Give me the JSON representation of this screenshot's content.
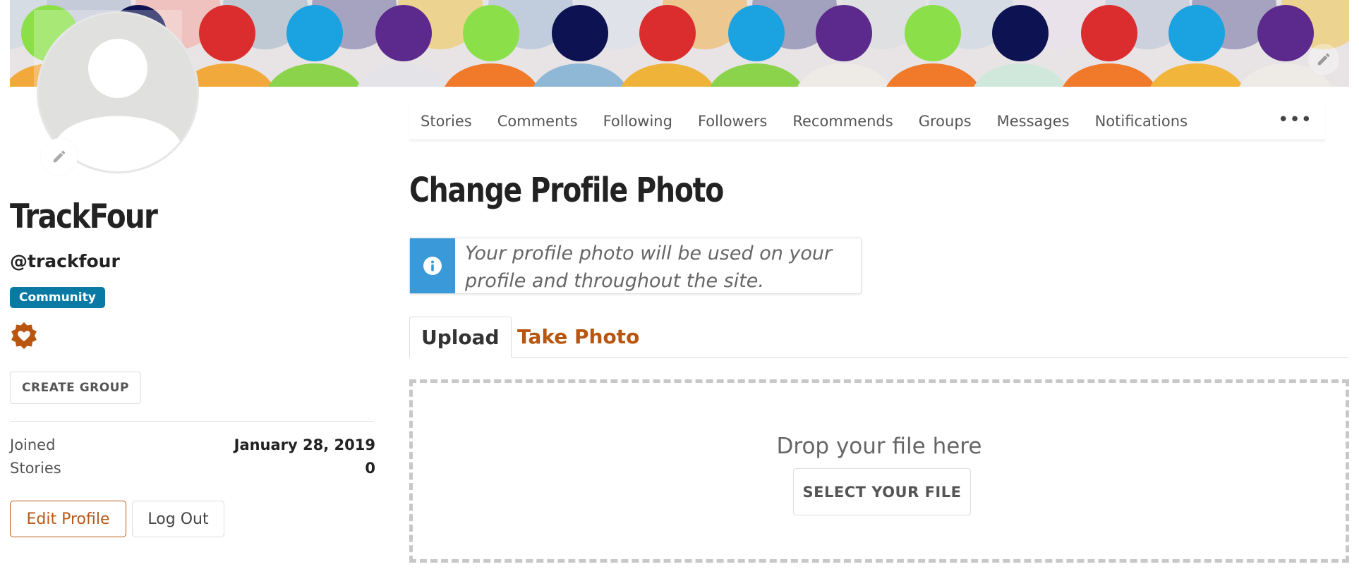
{
  "profile": {
    "username": "TrackFour",
    "handle": "@trackfour",
    "role_badge": "Community",
    "create_group_label": "CREATE GROUP",
    "stats": [
      {
        "label": "Joined",
        "value": "January 28, 2019"
      },
      {
        "label": "Stories",
        "value": "0"
      }
    ],
    "edit_profile_label": "Edit Profile",
    "logout_label": "Log Out"
  },
  "nav": {
    "items": [
      "Stories",
      "Comments",
      "Following",
      "Followers",
      "Recommends",
      "Groups",
      "Messages",
      "Notifications"
    ],
    "more_label": "•••"
  },
  "main": {
    "title": "Change Profile Photo",
    "info_message": "Your profile photo will be used on your profile and throughout the site.",
    "tabs": [
      "Upload",
      "Take Photo"
    ],
    "active_tab": "Upload",
    "drop_text": "Drop your file here",
    "select_file_label": "SELECT YOUR FILE"
  },
  "colors": {
    "accent": "#b8560f",
    "badge": "#0a7aa4",
    "info": "#3a9ad9"
  },
  "icons": {
    "cover_edit": "pencil-icon",
    "avatar_edit": "pencil-icon",
    "award": "heart-badge-icon",
    "info": "info-icon"
  }
}
